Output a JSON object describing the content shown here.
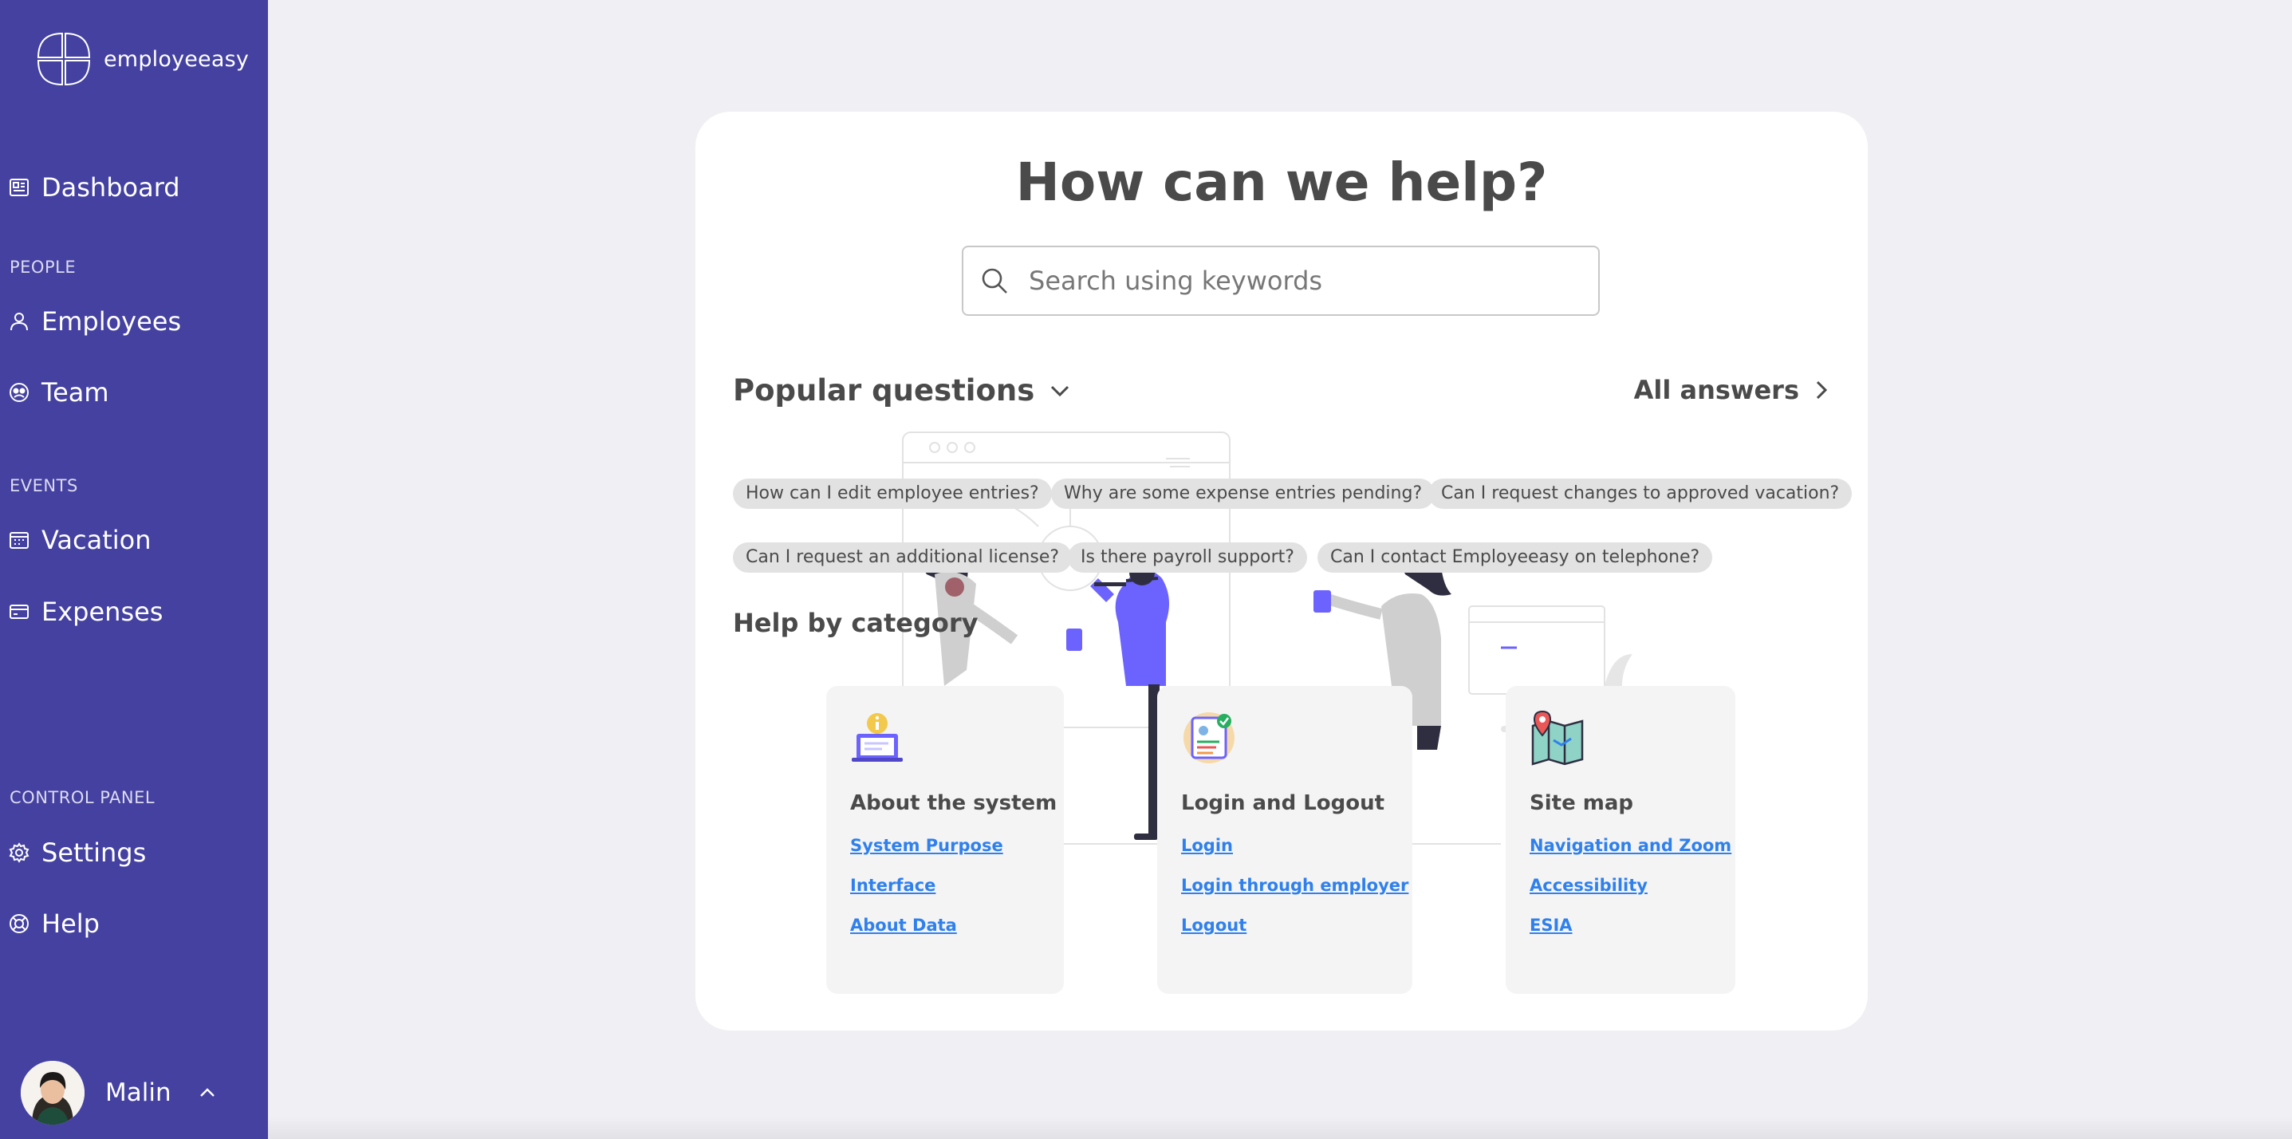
{
  "app": {
    "name": "employeeasy"
  },
  "sidebar": {
    "dashboard": "Dashboard",
    "section_people": "PEOPLE",
    "employees": "Employees",
    "team": "Team",
    "section_events": "EVENTS",
    "vacation": "Vacation",
    "expenses": "Expenses",
    "section_control": "CONTROL PANEL",
    "settings": "Settings",
    "help": "Help",
    "user_name": "Malin"
  },
  "help": {
    "title": "How can we help?",
    "search_placeholder": "Search using keywords",
    "popular_title": "Popular questions",
    "all_answers": "All answers",
    "questions": [
      "How can I edit employee entries?",
      "Why are some expense entries pending?",
      "Can I request changes to approved vacation?",
      "Can I request an additional license?",
      "Is there payroll support?",
      "Can I contact Employeeasy on telephone?"
    ],
    "category_title": "Help by category",
    "categories": [
      {
        "title": "About the system",
        "icon": "laptop-info-icon",
        "links": [
          "System Purpose",
          "Interface",
          "About Data"
        ]
      },
      {
        "title": "Login and Logout",
        "icon": "id-card-check-icon",
        "links": [
          "Login",
          "Login through employer",
          "Logout"
        ]
      },
      {
        "title": "Site map",
        "icon": "map-pin-icon",
        "links": [
          "Navigation and Zoom",
          "Accessibility",
          "ESIA"
        ]
      }
    ]
  },
  "colors": {
    "sidebar": "#4441a1",
    "accent": "#6c63ff",
    "link": "#2f80ed",
    "background": "#f0eff4"
  }
}
